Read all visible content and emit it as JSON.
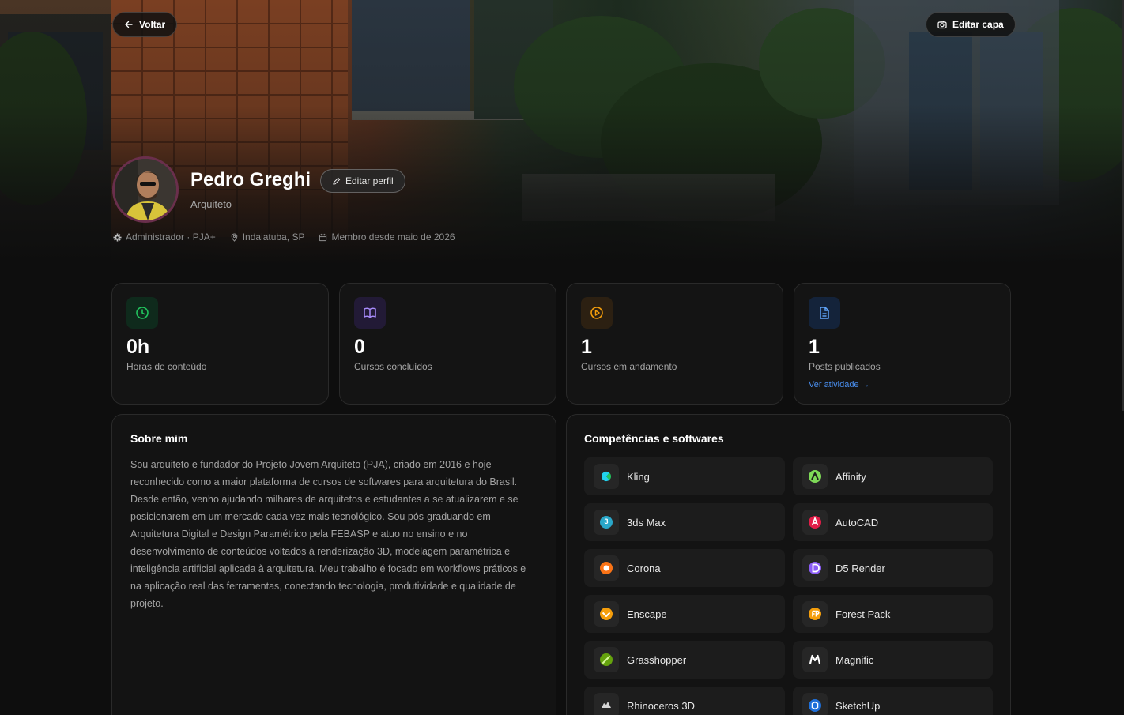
{
  "header": {
    "back_label": "Voltar",
    "edit_cover_label": "Editar capa"
  },
  "profile": {
    "name": "Pedro Greghi",
    "role": "Arquiteto",
    "edit_profile_label": "Editar perfil",
    "meta": {
      "admin": "Administrador · PJA+",
      "location": "Indaiatuba, SP",
      "member_since": "Membro desde maio de 2026"
    }
  },
  "stats": [
    {
      "value": "0h",
      "label": "Horas de conteúdo",
      "icon": "clock-icon",
      "color": "#22c55e",
      "bg": "#0f2a1c"
    },
    {
      "value": "0",
      "label": "Cursos concluídos",
      "icon": "book-icon",
      "color": "#a78bfa",
      "bg": "#221a36"
    },
    {
      "value": "1",
      "label": "Cursos em andamento",
      "icon": "play-icon",
      "color": "#f59e0b",
      "bg": "#2c2012"
    },
    {
      "value": "1",
      "label": "Posts publicados",
      "icon": "document-icon",
      "color": "#60a5fa",
      "bg": "#14233a",
      "link": "Ver atividade →"
    }
  ],
  "about": {
    "title": "Sobre mim",
    "text": "Sou arquiteto e fundador do Projeto Jovem Arquiteto (PJA), criado em 2016 e hoje reconhecido como a maior plataforma de cursos de softwares para arquitetura do Brasil. Desde então, venho ajudando milhares de arquitetos e estudantes a se atualizarem e se posicionarem em um mercado cada vez mais tecnológico. Sou pós-graduando em Arquitetura Digital e Design Paramétrico pela FEBASP e atuo no ensino e no desenvolvimento de conteúdos voltados à renderização 3D, modelagem paramétrica e inteligência artificial aplicada à arquitetura. Meu trabalho é focado em workflows práticos e na aplicação real das ferramentas, conectando tecnologia, produtividade e qualidade de projeto."
  },
  "skills": {
    "title": "Competências e softwares",
    "items": [
      {
        "name": "Kling",
        "icon": "kling-icon",
        "color": "#22d3ee"
      },
      {
        "name": "Affinity",
        "icon": "affinity-icon",
        "color": "#7ed957"
      },
      {
        "name": "3ds Max",
        "icon": "3dsmax-icon",
        "color": "#2aa7c9"
      },
      {
        "name": "AutoCAD",
        "icon": "autocad-icon",
        "color": "#e11d48"
      },
      {
        "name": "Corona",
        "icon": "corona-icon",
        "color": "#f97316"
      },
      {
        "name": "D5 Render",
        "icon": "d5render-icon",
        "color": "#8b5cf6"
      },
      {
        "name": "Enscape",
        "icon": "enscape-icon",
        "color": "#f59e0b"
      },
      {
        "name": "Forest Pack",
        "icon": "forestpack-icon",
        "color": "#f59e0b"
      },
      {
        "name": "Grasshopper",
        "icon": "grasshopper-icon",
        "color": "#65a30d"
      },
      {
        "name": "Magnific",
        "icon": "magnific-icon",
        "color": "#ffffff"
      },
      {
        "name": "Rhinoceros 3D",
        "icon": "rhino-icon",
        "color": "#d4d4d4"
      },
      {
        "name": "SketchUp",
        "icon": "sketchup-icon",
        "color": "#1e6fd9"
      }
    ]
  }
}
